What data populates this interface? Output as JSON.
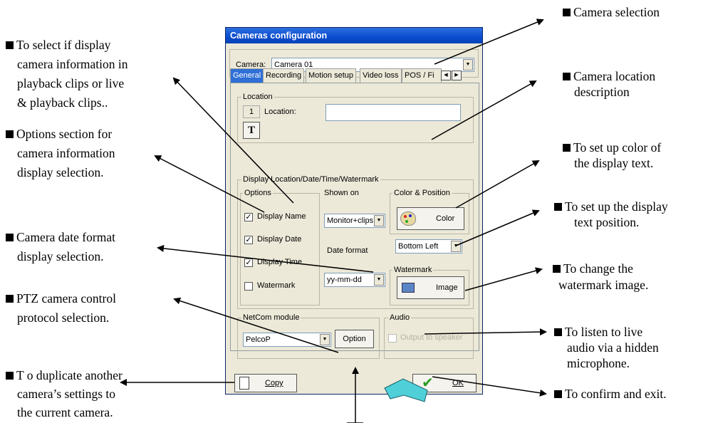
{
  "window": {
    "title": "Cameras configuration"
  },
  "camera": {
    "label": "Camera:",
    "value": "Camera 01"
  },
  "tabs": [
    "General",
    "Recording",
    "Motion setup",
    "Video loss",
    "POS / Fi"
  ],
  "location": {
    "group": "Location",
    "number": "1",
    "label": "Location:",
    "value": "",
    "text_icon": "T"
  },
  "display": {
    "group": "Display Location/Date/Time/Watermark",
    "options_label": "Options",
    "display_name": "Display Name",
    "display_date": "Display Date",
    "display_time": "Display Time",
    "watermark": "Watermark",
    "checks": [
      true,
      true,
      true,
      false
    ],
    "shown_on_label": "Shown on",
    "shown_on_value": "Monitor+clips",
    "date_format_label": "Date format",
    "date_format_value": "yy-mm-dd",
    "color_position_label": "Color & Position",
    "color_button": "Color",
    "position_value": "Bottom Left",
    "watermark_group": "Watermark",
    "image_button": "Image"
  },
  "netcom": {
    "group": "NetCom module",
    "value": "PelcoP",
    "option_button": "Option"
  },
  "audio": {
    "group": "Audio",
    "output": "Output to speaker"
  },
  "buttons": {
    "copy": "Copy",
    "ok": "OK"
  },
  "annotations": {
    "camera_selection": "Camera selection",
    "location_desc_1": "Camera location",
    "location_desc_2": "description",
    "color_1": "To set up color of",
    "color_2": "the display text.",
    "position_1": "To set up the display",
    "position_2": "text position.",
    "watermark_1": "To change the",
    "watermark_2": "watermark image.",
    "audio_1": "To listen to live",
    "audio_2": "audio via a hidden",
    "audio_3": "microphone.",
    "confirm": "To confirm and exit.",
    "select_1": "To select if display",
    "select_2": "camera information in",
    "select_3": "playback clips or live",
    "select_4": "& playback clips..",
    "options_1": "Options section for",
    "options_2": "camera information",
    "options_3": "display selection.",
    "date_1": "Camera date format",
    "date_2": "display selection.",
    "ptz_1": "PTZ camera control",
    "ptz_2": "protocol selection.",
    "dup_1": "T o duplicate another",
    "dup_2": "camera’s settings to",
    "dup_3": "the current camera."
  }
}
